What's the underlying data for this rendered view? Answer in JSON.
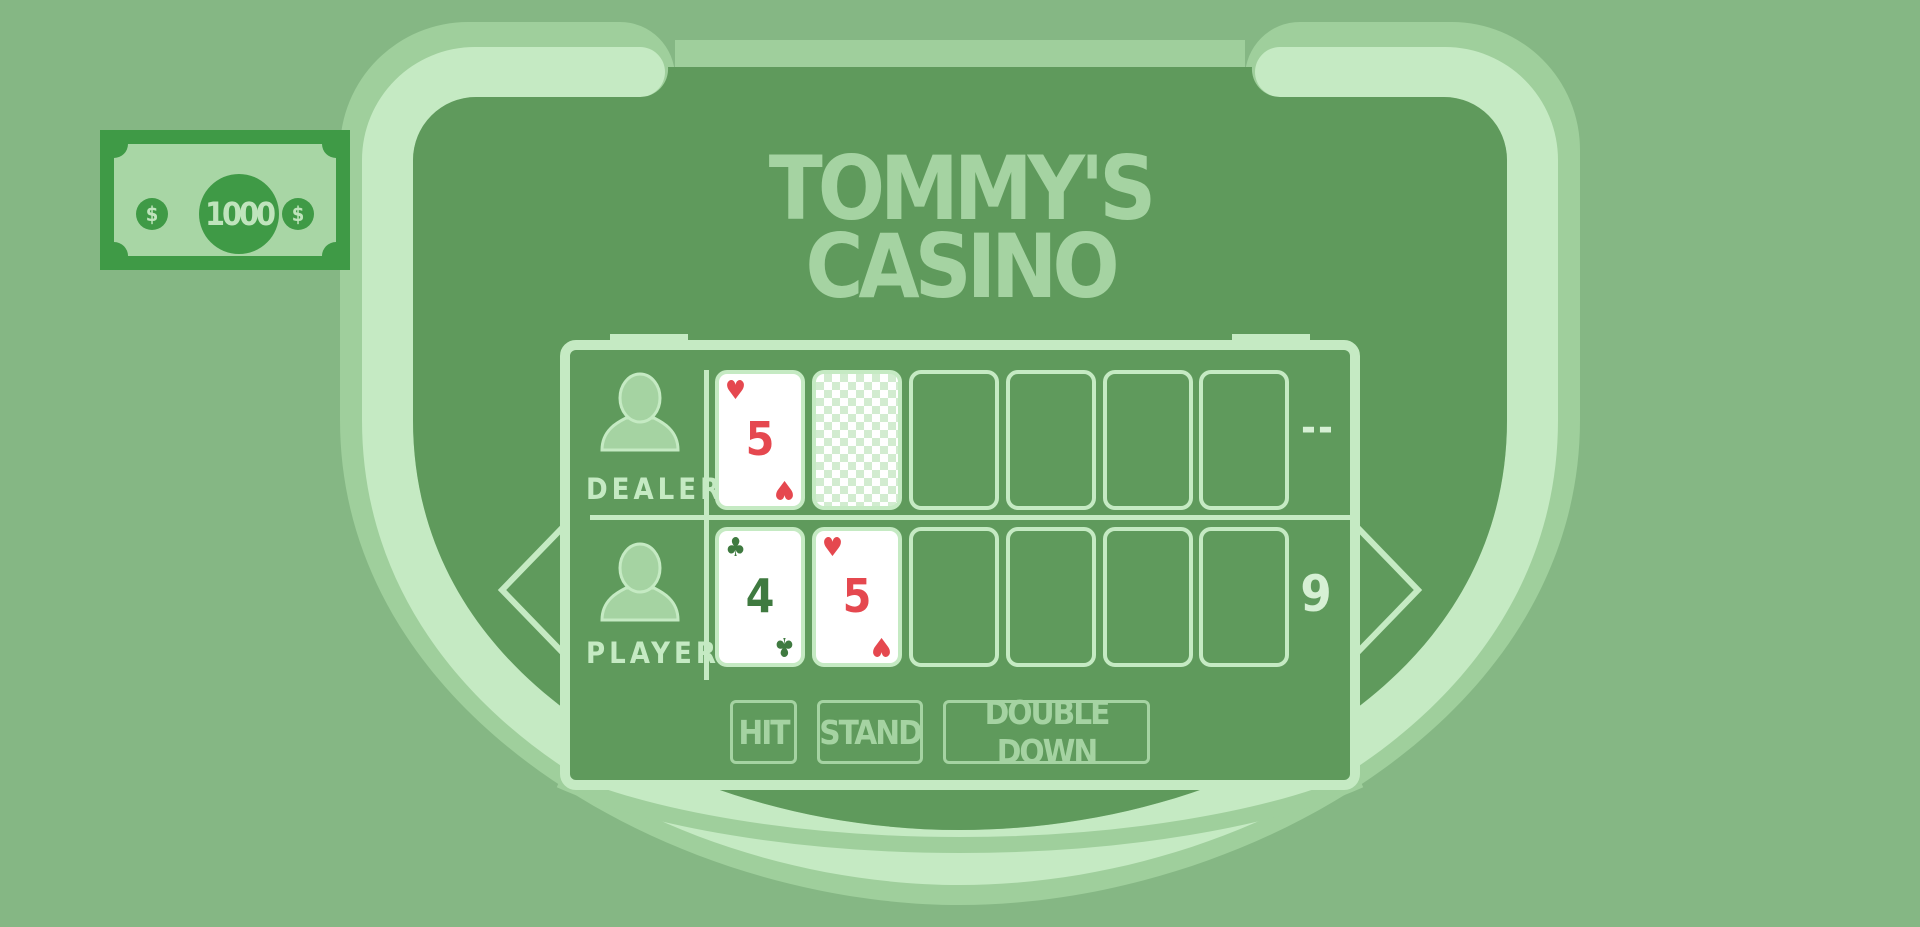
{
  "bankroll": {
    "amount": "1000",
    "currency_symbol": "$"
  },
  "title": {
    "line1": "TOMMY'S",
    "line2": "CASINO"
  },
  "dealer": {
    "label": "DEALER",
    "score": "--",
    "cards": [
      {
        "rank": "5",
        "suit": "♥",
        "color": "red",
        "face_up": true
      },
      {
        "face_up": false
      }
    ]
  },
  "player": {
    "label": "PLAYER",
    "score": "9",
    "cards": [
      {
        "rank": "4",
        "suit": "♣",
        "color": "green",
        "face_up": true
      },
      {
        "rank": "5",
        "suit": "♥",
        "color": "red",
        "face_up": true
      }
    ]
  },
  "actions": {
    "hit": "HIT",
    "stand": "STAND",
    "double_down": "DOUBLE DOWN"
  },
  "colors": {
    "background": "#85b784",
    "table_felt": "#5f9a5c",
    "rail_light": "#c5eac3",
    "card_red": "#e5484f",
    "card_green": "#3f7a40",
    "money_green": "#3f9a46"
  }
}
